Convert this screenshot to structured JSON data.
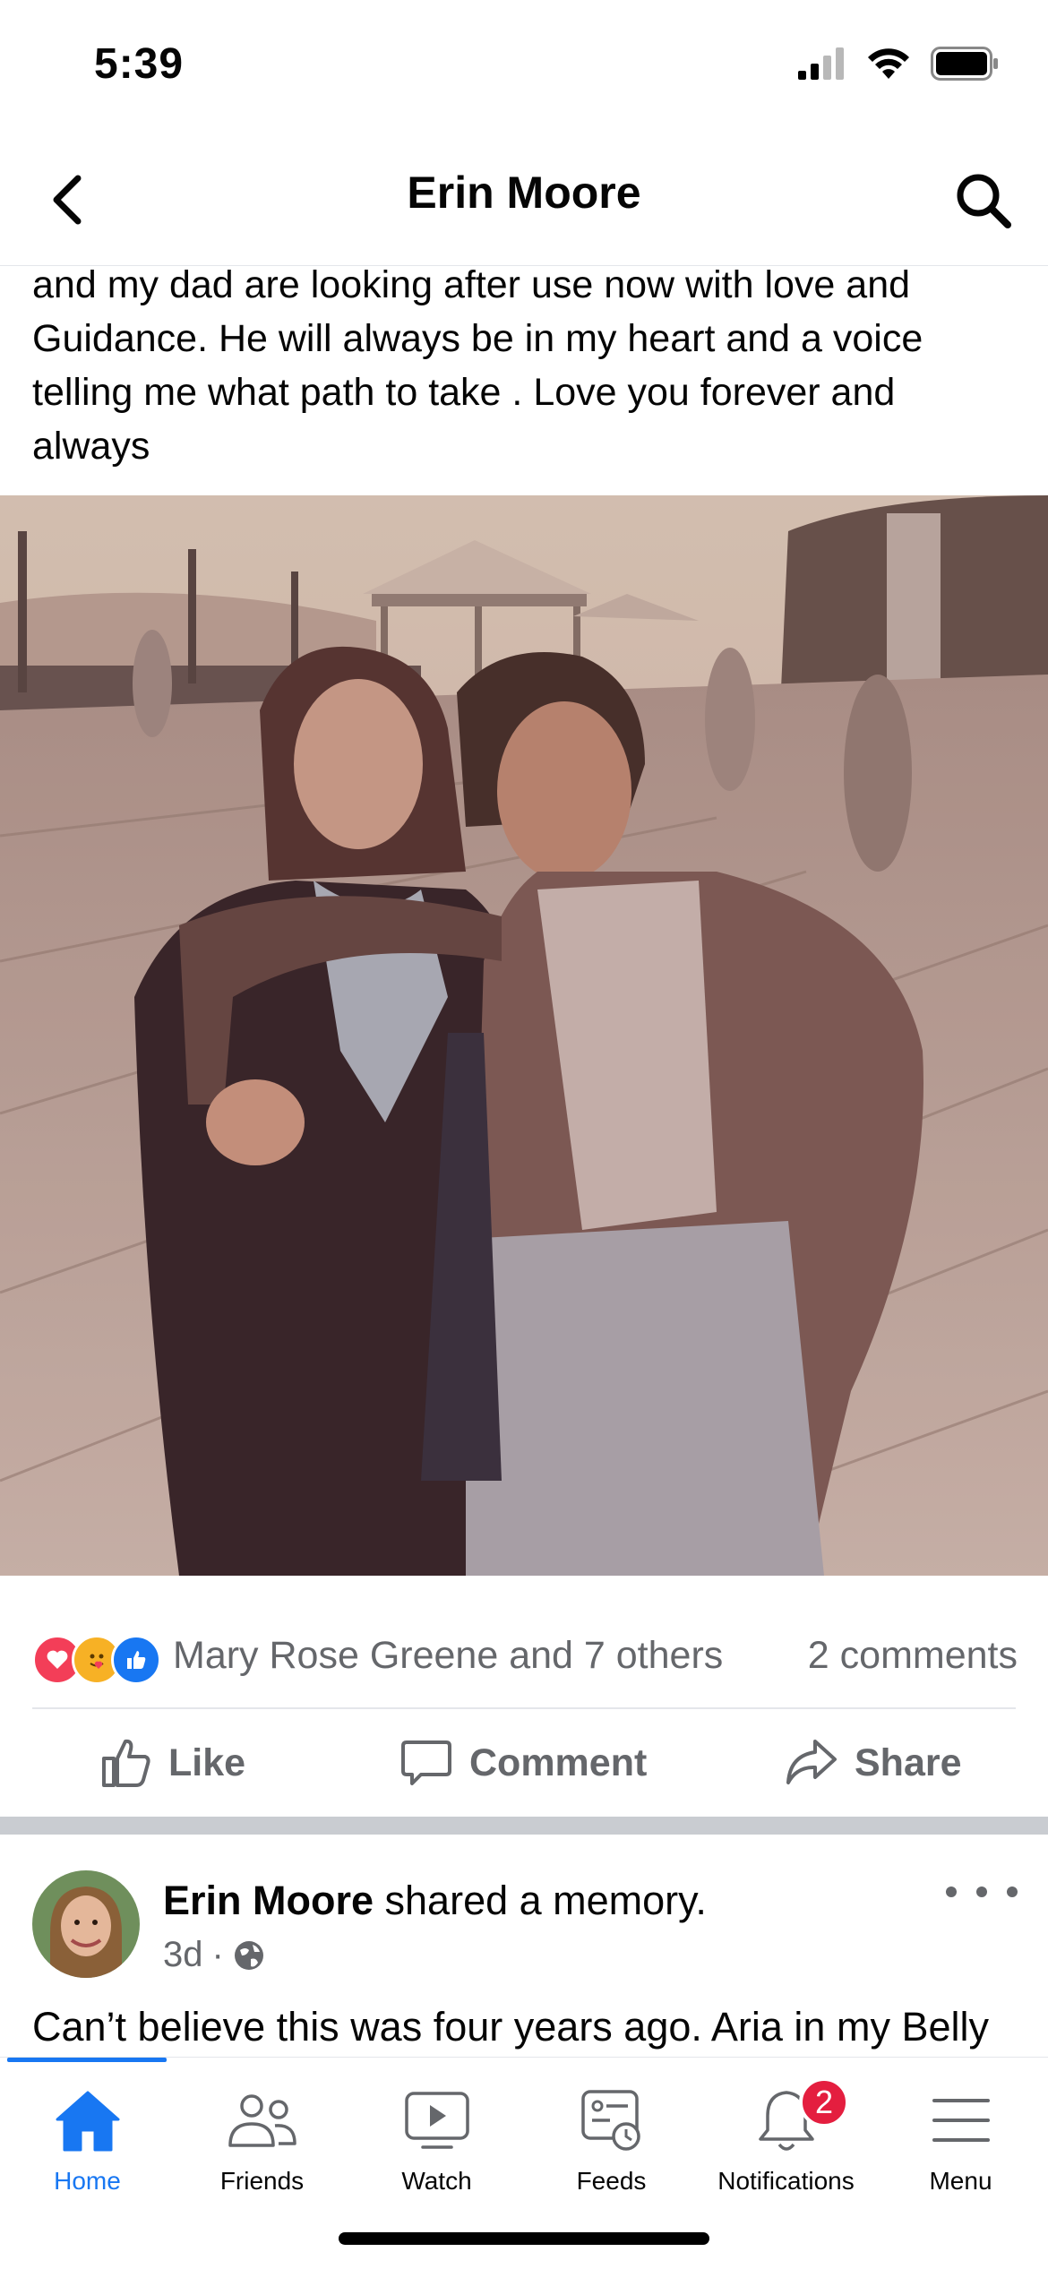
{
  "status_bar": {
    "time": "5:39"
  },
  "header": {
    "title": "Erin Moore"
  },
  "post": {
    "text_lines": [
      "and my dad are looking after use now with love and",
      "Guidance. He will always be in my heart and a voice",
      "telling me what path to take . Love you forever and",
      "always"
    ],
    "reactors": "Mary Rose Greene and 7 others",
    "comments": "2 comments"
  },
  "actions": {
    "like": "Like",
    "comment": "Comment",
    "share": "Share"
  },
  "next_post": {
    "author": "Erin Moore",
    "action": " shared a memory.",
    "time": "3d",
    "separator": "·",
    "text": "Can’t believe this was four years ago. Aria in my Belly"
  },
  "tabs": [
    {
      "label": "Home",
      "icon": "home-icon"
    },
    {
      "label": "Friends",
      "icon": "friends-icon"
    },
    {
      "label": "Watch",
      "icon": "watch-icon"
    },
    {
      "label": "Feeds",
      "icon": "feeds-icon"
    },
    {
      "label": "Notifications",
      "icon": "bell-icon",
      "badge": "2"
    },
    {
      "label": "Menu",
      "icon": "menu-icon"
    }
  ],
  "colors": {
    "accent": "#1877f2",
    "badge": "#e41e3f",
    "secondary_text": "#65676b"
  }
}
